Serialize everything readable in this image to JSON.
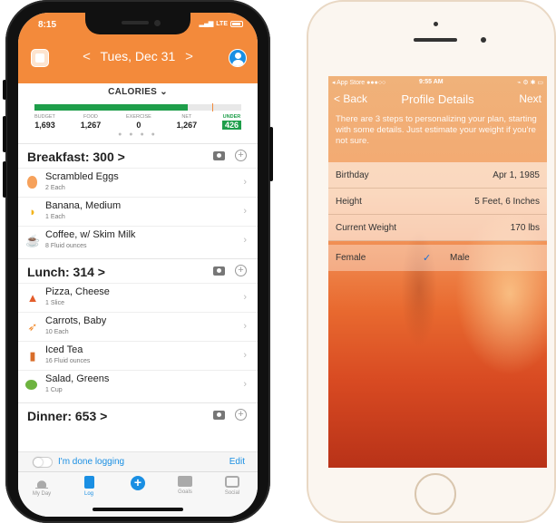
{
  "left_phone": {
    "status": {
      "time": "8:15",
      "network": "LTE"
    },
    "date_nav": {
      "prev": "<",
      "date": "Tues, Dec 31",
      "next": ">"
    },
    "calories": {
      "title": "CALORIES",
      "caret": "⌄",
      "budget_fraction": 0.74,
      "stats": [
        {
          "label": "BUDGET",
          "value": "1,693"
        },
        {
          "label": "FOOD",
          "value": "1,267"
        },
        {
          "label": "EXERCISE",
          "value": "0"
        },
        {
          "label": "NET",
          "value": "1,267"
        },
        {
          "label": "UNDER",
          "value": "426"
        }
      ],
      "page_dots": "● ● ● ●",
      "colors": {
        "accent": "#f38a3b",
        "under": "#1e9e4a",
        "link": "#1a8fe3"
      }
    },
    "meals": [
      {
        "title": "Breakfast: 300 >",
        "foods": [
          {
            "icon": "egg-icon",
            "name": "Scrambled Eggs",
            "qty": "2 Each"
          },
          {
            "icon": "banana-icon",
            "name": "Banana, Medium",
            "qty": "1 Each"
          },
          {
            "icon": "coffee-icon",
            "name": "Coffee, w/ Skim Milk",
            "qty": "8 Fluid ounces"
          }
        ]
      },
      {
        "title": "Lunch: 314 >",
        "foods": [
          {
            "icon": "pizza-icon",
            "name": "Pizza, Cheese",
            "qty": "1 Slice"
          },
          {
            "icon": "carrot-icon",
            "name": "Carrots, Baby",
            "qty": "10 Each"
          },
          {
            "icon": "iced-tea-icon",
            "name": "Iced Tea",
            "qty": "16 Fluid ounces"
          },
          {
            "icon": "salad-icon",
            "name": "Salad, Greens",
            "qty": "1 Cup"
          }
        ]
      },
      {
        "title": "Dinner: 653 >",
        "foods": []
      }
    ],
    "done_logging": {
      "label": "I'm done logging",
      "edit": "Edit"
    },
    "tabs": [
      {
        "label": "My Day",
        "icon": "sun-icon"
      },
      {
        "label": "Log",
        "icon": "clipboard-icon",
        "active": true
      },
      {
        "label": "",
        "icon": "plus-icon"
      },
      {
        "label": "Goals",
        "icon": "goals-icon"
      },
      {
        "label": "Social",
        "icon": "social-icon"
      }
    ]
  },
  "right_phone": {
    "status": {
      "carrier": "◂ App Store ●●●○○",
      "time": "9:55 AM",
      "right": "⌁ ⚙ ✱ ▭"
    },
    "nav": {
      "back": "< Back",
      "title": "Profile Details",
      "next": "Next"
    },
    "intro": "There are 3 steps to personalizing your plan, starting with some details. Just estimate your weight if you're not sure.",
    "fields": [
      {
        "label": "Birthday",
        "value": "Apr 1, 1985"
      },
      {
        "label": "Height",
        "value": "5 Feet, 6 Inches"
      },
      {
        "label": "Current Weight",
        "value": "170 lbs"
      }
    ],
    "gender": {
      "female": "Female",
      "check": "✓",
      "male": "Male"
    }
  }
}
